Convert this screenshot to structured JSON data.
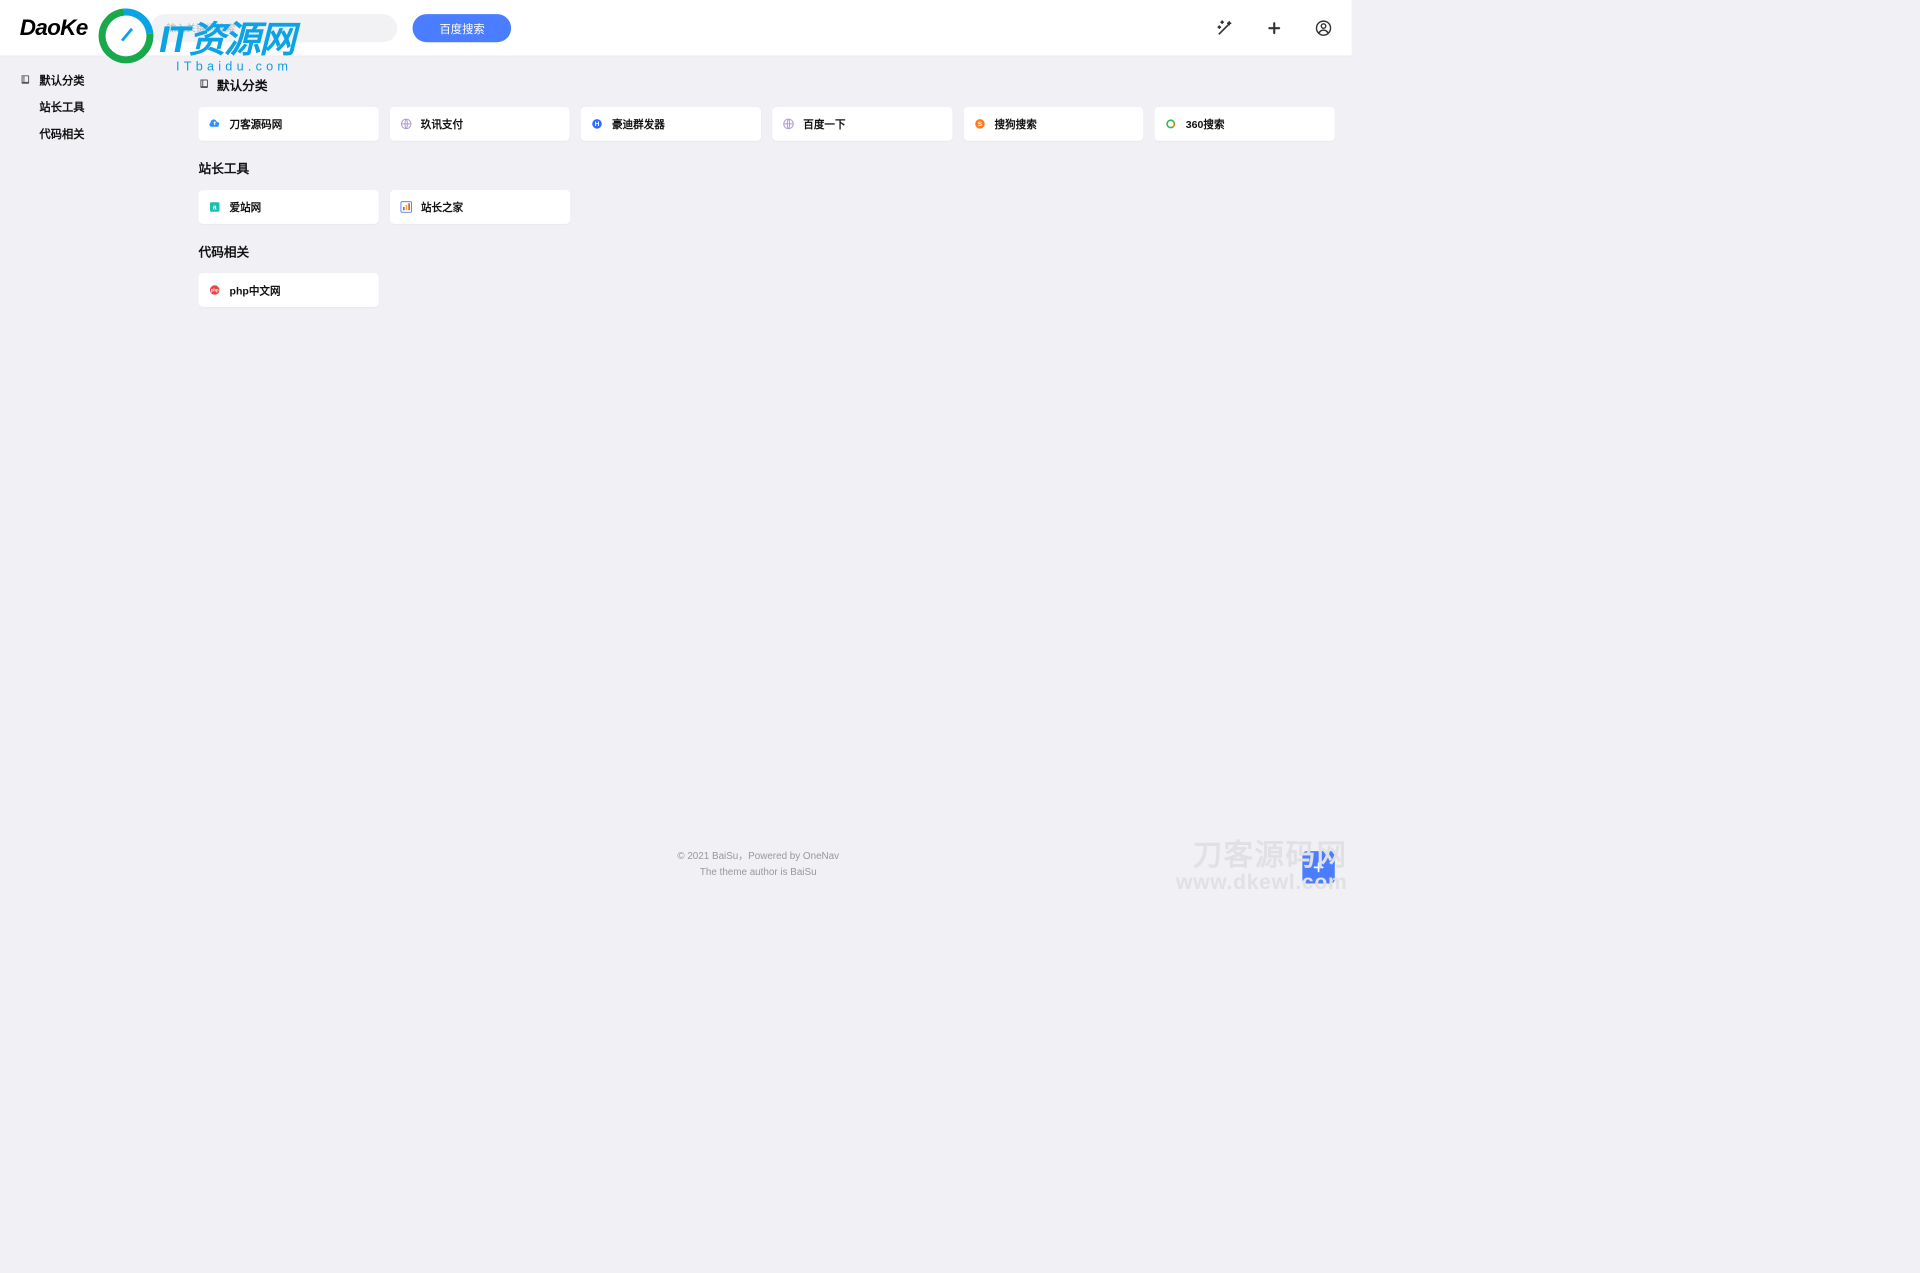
{
  "header": {
    "logo_text": "DaoKe",
    "search_placeholder": "输入关键词搜索",
    "search_button_label": "百度搜索"
  },
  "sidebar": {
    "items": [
      {
        "label": "默认分类"
      },
      {
        "label": "站长工具"
      },
      {
        "label": "代码相关"
      }
    ]
  },
  "sections": [
    {
      "title": "默认分类",
      "cards": [
        {
          "label": "刀客源码网",
          "icon": "cloud-upload",
          "color": "#2b91ff"
        },
        {
          "label": "玖讯支付",
          "icon": "globe",
          "color": "#b09cd8"
        },
        {
          "label": "豪迪群发器",
          "icon": "circle-h",
          "color": "#2b6bff"
        },
        {
          "label": "百度一下",
          "icon": "globe",
          "color": "#b09cd8"
        },
        {
          "label": "搜狗搜索",
          "icon": "circle-s",
          "color": "#ff7a1a"
        },
        {
          "label": "360搜索",
          "icon": "ring-360",
          "color": "#2bbf4a"
        }
      ]
    },
    {
      "title": "站长工具",
      "cards": [
        {
          "label": "爱站网",
          "icon": "square-a",
          "color": "#1abfb0"
        },
        {
          "label": "站长之家",
          "icon": "bar-chart",
          "color": "#4a6bd6"
        }
      ]
    },
    {
      "title": "代码相关",
      "cards": [
        {
          "label": "php中文网",
          "icon": "circle-php",
          "color": "#e84444"
        }
      ]
    }
  ],
  "footer": {
    "line1": "© 2021 BaiSu，Powered by OneNav",
    "line2": "The theme author is BaiSu"
  },
  "watermark1": {
    "brand": "IT资源网",
    "url": "ITbaidu.com"
  },
  "watermark2": {
    "brand": "刀客源码网",
    "url": "www.dkewl.com"
  }
}
